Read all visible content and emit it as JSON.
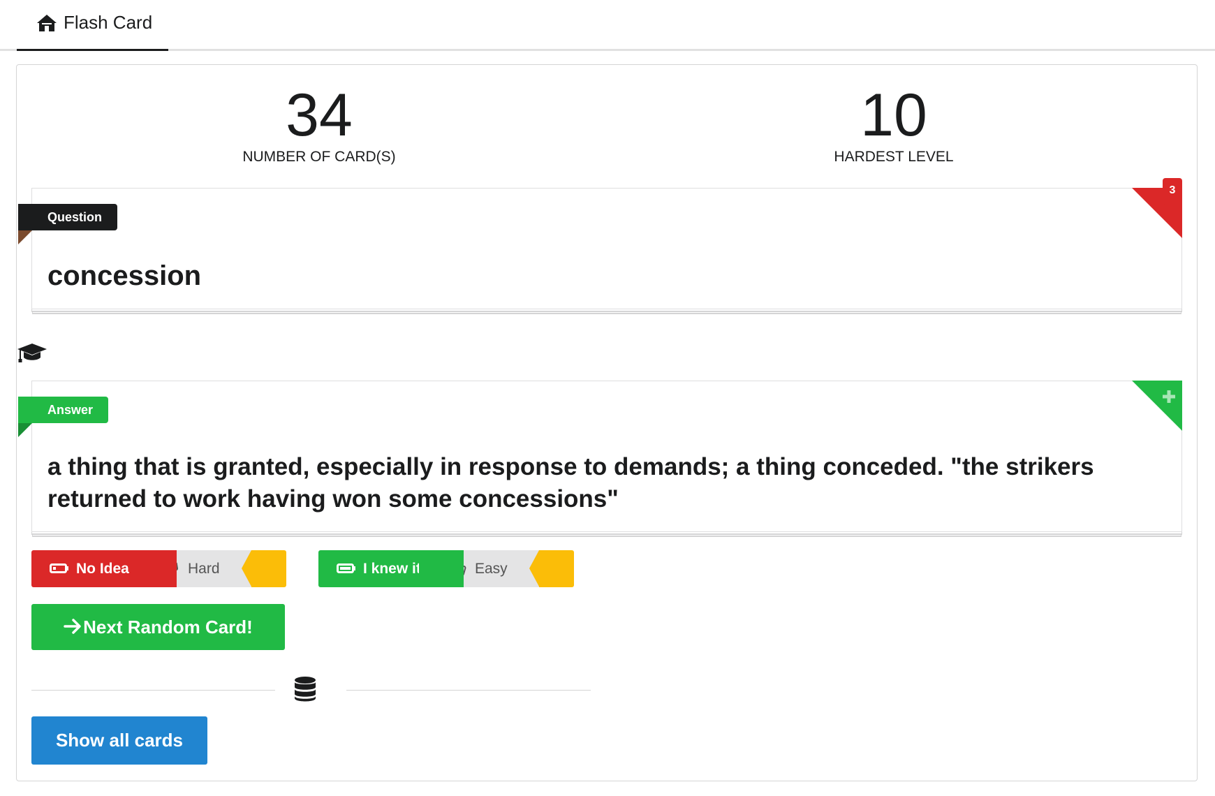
{
  "nav": {
    "tab_label": "Flash Card",
    "tab_icon": "home-icon"
  },
  "stats": [
    {
      "value": "34",
      "label": "NUMBER OF CARD(S)"
    },
    {
      "value": "10",
      "label": "HARDEST LEVEL"
    }
  ],
  "question_card": {
    "ribbon": "Question",
    "text": "concession",
    "corner_badge": "3"
  },
  "answer_card": {
    "ribbon": "Answer",
    "text": "a thing that is granted, especially in response to demands; a thing conceded. \"the strikers returned to work having won some concessions\"",
    "corner_icon": "plus-icon"
  },
  "rating": {
    "no_idea": {
      "main_label": "No Idea",
      "alt_label": "Hard"
    },
    "knew_it": {
      "main_label": "I knew it",
      "alt_label": "Easy"
    }
  },
  "actions": {
    "next_label": "Next Random Card!",
    "show_all_label": "Show all cards"
  },
  "colors": {
    "red": "#db2828",
    "green": "#21ba45",
    "yellow": "#fbbd08",
    "blue": "#2185d0",
    "dark": "#1b1c1d"
  }
}
